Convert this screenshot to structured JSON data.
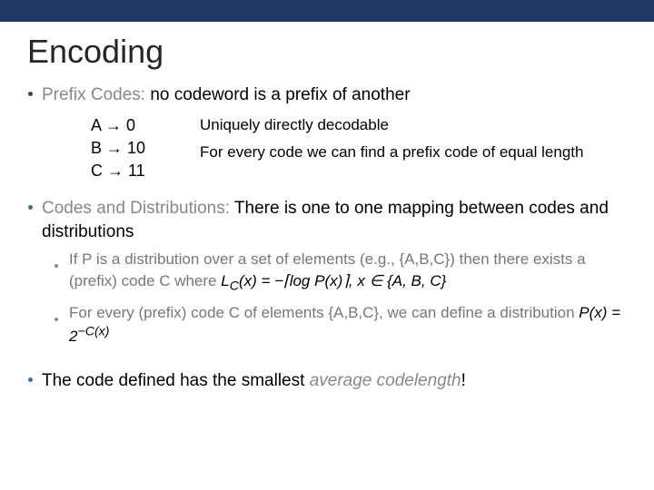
{
  "title": "Encoding",
  "prefix": {
    "heading": "Prefix Codes:",
    "heading_rest": " no codeword is a prefix of another",
    "codes": {
      "a": "A → 0",
      "b": "B → 10",
      "c": "C → 11"
    },
    "desc1": "Uniquely directly decodable",
    "desc2": "For every code we can find a prefix code of equal length"
  },
  "dist": {
    "heading": "Codes and Distributions:",
    "heading_rest": " There is one to one mapping between codes and distributions",
    "sub1a": "If P is a distribution over a set of elements (e.g., {A,B,C}) then there exists a (prefix) code C where ",
    "sub1b_math": "L_C(x) = −⌈log P(x)⌉, x ∈ {A, B, C}",
    "sub2a": "For every (prefix) code C of elements {A,B,C}, we can define a distribution ",
    "sub2b_math": "P(x) = 2^{−C(x)}"
  },
  "final": {
    "a": "The code defined has the smallest ",
    "b": "average codelength",
    "c": "!"
  }
}
